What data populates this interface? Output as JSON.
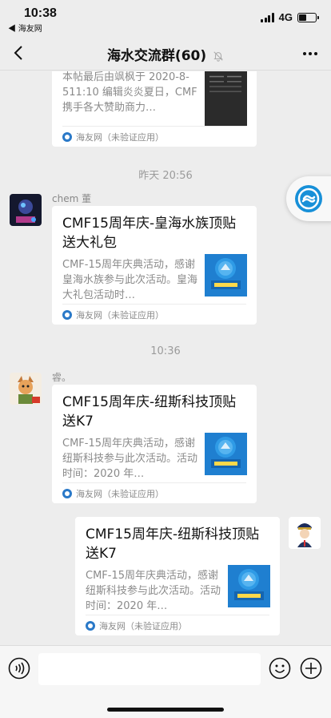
{
  "status_bar": {
    "time": "10:38",
    "back_app": "◀ 海友网",
    "network": "4G",
    "signal_icon": "signal-bars-icon",
    "battery_icon": "battery-icon"
  },
  "nav": {
    "title": "海水交流群(60)",
    "back_icon": "chevron-left-icon",
    "mute_icon": "bell-slash-icon",
    "more_icon": "more-dots-icon"
  },
  "messages": [
    {
      "type": "link-card",
      "side": "left",
      "desc": "本帖最后由飒枫于 2020-8-511:10 编辑炎炎夏日，CMF 携手各大赞助商力…",
      "source": "海友网（未验证应用）"
    },
    {
      "timestamp": "昨天 20:56"
    },
    {
      "type": "link-card",
      "side": "left",
      "sender": "chem 董",
      "title": "CMF15周年庆-皇海水族顶贴送大礼包",
      "desc": "CMF-15周年庆典活动，感谢皇海水族参与此次活动。皇海大礼包活动时…",
      "source": "海友网（未验证应用）"
    },
    {
      "timestamp": "10:36"
    },
    {
      "type": "link-card",
      "side": "left",
      "sender": "䜭。",
      "title": "CMF15周年庆-纽斯科技顶贴送K7",
      "desc": "CMF-15周年庆典活动，感谢纽斯科技参与此次活动。活动时间：2020 年…",
      "source": "海友网（未验证应用）"
    },
    {
      "type": "link-card",
      "side": "right",
      "title": "CMF15周年庆-纽斯科技顶贴送K7",
      "desc": "CMF-15周年庆典活动，感谢纽斯科技参与此次活动。活动时间：2020 年…",
      "source": "海友网（未验证应用）"
    }
  ],
  "input_bar": {
    "placeholder": "",
    "voice_icon": "voice-icon",
    "emoji_icon": "emoji-icon",
    "plus_icon": "plus-circle-icon"
  },
  "colors": {
    "background": "#ededed",
    "card": "#ffffff",
    "accent_blue": "#1890d8",
    "muted_text": "#8a8a8a"
  }
}
